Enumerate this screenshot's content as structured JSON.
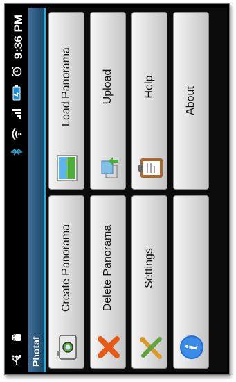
{
  "status": {
    "time": "9:36 PM"
  },
  "app": {
    "title": "Photaf"
  },
  "menu": {
    "create_panorama": "Create Panorama",
    "load_panorama": "Load Panorama",
    "delete_panorama": "Delete Panorama",
    "upload": "Upload",
    "settings": "Settings",
    "help": "Help",
    "about": "About"
  },
  "colors": {
    "titlebar": "#1c4769",
    "accent": "#2fa7d8"
  },
  "icons": [
    "usb-icon",
    "android-debug-icon",
    "clock-alarm-icon",
    "battery-icon",
    "signal-icon",
    "wifi-icon",
    "bluetooth-icon",
    "camera-icon",
    "panorama-image-icon",
    "delete-x-icon",
    "upload-icon",
    "settings-tools-icon",
    "help-clipboard-icon",
    "info-icon"
  ]
}
